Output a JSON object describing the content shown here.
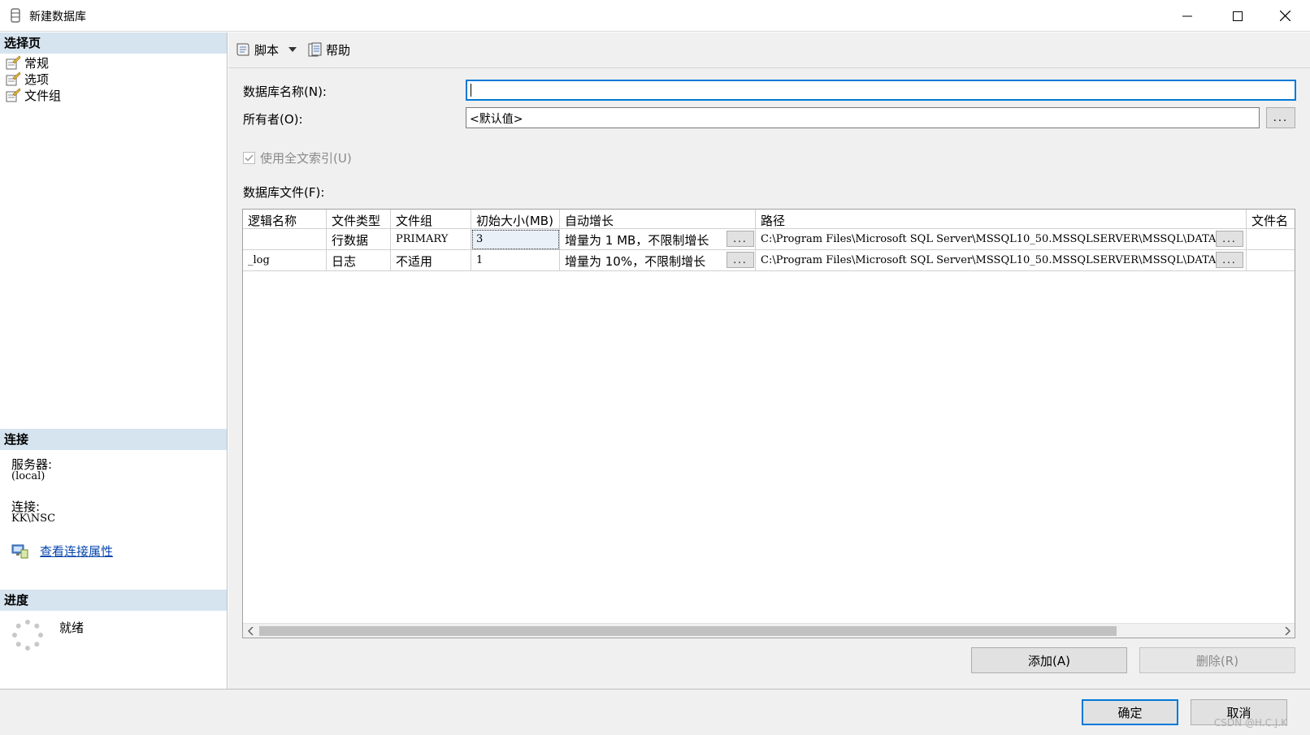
{
  "window": {
    "title": "新建数据库"
  },
  "left": {
    "select_page_header": "选择页",
    "pages": [
      {
        "label": "常规"
      },
      {
        "label": "选项"
      },
      {
        "label": "文件组"
      }
    ],
    "connection_header": "连接",
    "server_label": "服务器:",
    "server_value": "(local)",
    "connection_label": "连接:",
    "connection_value": "KK\\NSC",
    "view_props_link": "查看连接属性",
    "progress_header": "进度",
    "progress_status": "就绪"
  },
  "toolbar": {
    "script_label": "脚本",
    "help_label": "帮助"
  },
  "form": {
    "db_name_label": "数据库名称(N):",
    "db_name_value": "",
    "owner_label": "所有者(O):",
    "owner_value": "<默认值>",
    "ellipsis": "...",
    "fulltext_label": "使用全文索引(U)",
    "fulltext_checked": true,
    "files_label": "数据库文件(F):"
  },
  "grid": {
    "headers": [
      "逻辑名称",
      "文件类型",
      "文件组",
      "初始大小(MB)",
      "自动增长",
      "路径",
      "文件名"
    ],
    "rows": [
      {
        "logical_name": "",
        "file_type": "行数据",
        "filegroup": "PRIMARY",
        "initial_size": "3",
        "autogrowth": "增量为 1 MB，不限制增长",
        "path": "C:\\Program Files\\Microsoft SQL Server\\MSSQL10_50.MSSQLSERVER\\MSSQL\\DATA",
        "file_name": ""
      },
      {
        "logical_name": "_log",
        "file_type": "日志",
        "filegroup": "不适用",
        "initial_size": "1",
        "autogrowth": "增量为 10%，不限制增长",
        "path": "C:\\Program Files\\Microsoft SQL Server\\MSSQL10_50.MSSQLSERVER\\MSSQL\\DATA",
        "file_name": ""
      }
    ]
  },
  "buttons": {
    "add": "添加(A)",
    "remove": "删除(R)",
    "ok": "确定",
    "cancel": "取消"
  },
  "watermark": "CSDN @H.C.J.K",
  "colors": {
    "section_header_bg": "#d6e4f0",
    "focus_blue": "#0078d7",
    "link_blue": "#0645ad"
  }
}
